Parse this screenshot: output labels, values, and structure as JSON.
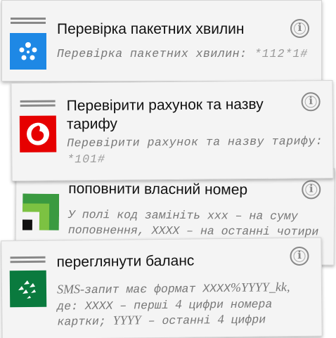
{
  "items": [
    {
      "title": "Перевірка пакетних хвилин",
      "description": "Перевірка пакетних хвилин:",
      "code": "*112*1#",
      "logo_color": "#1e88e5",
      "logo_icon": "kyivstar-star-icon"
    },
    {
      "title_line1": "Перевірити рахунок та назву",
      "title_line2": "тарифу",
      "description": "Перевірити рахунок та назву тарифу:",
      "code": "*101#",
      "logo_color": "#e60000",
      "logo_icon": "vodafone-quote-icon"
    },
    {
      "title": "поповнити власний номер",
      "description_line1": "У полі код замініть ххх – на суму",
      "description_line2": "поповнення, ХХХХ – на останні чотири",
      "logo_color": "#2e8b3a",
      "logo_icon": "privatbank-icon"
    },
    {
      "title": "переглянути баланс",
      "description_line1_a": "SMS-",
      "description_line1_b": "запит має формат ХХХХ",
      "description_line1_c": "%YYYY_kk,",
      "description_line2_a": "де: ХХХХ – перші ",
      "description_line2_b": "4",
      "description_line2_c": " цифри номера",
      "description_line3_a": "картки; ",
      "description_line3_b": "YYYY",
      "description_line3_c": " – останні ",
      "description_line3_d": "4",
      "description_line3_e": " цифри",
      "logo_color": "#0a7a3e",
      "logo_icon": "bank-birds-icon"
    }
  ]
}
